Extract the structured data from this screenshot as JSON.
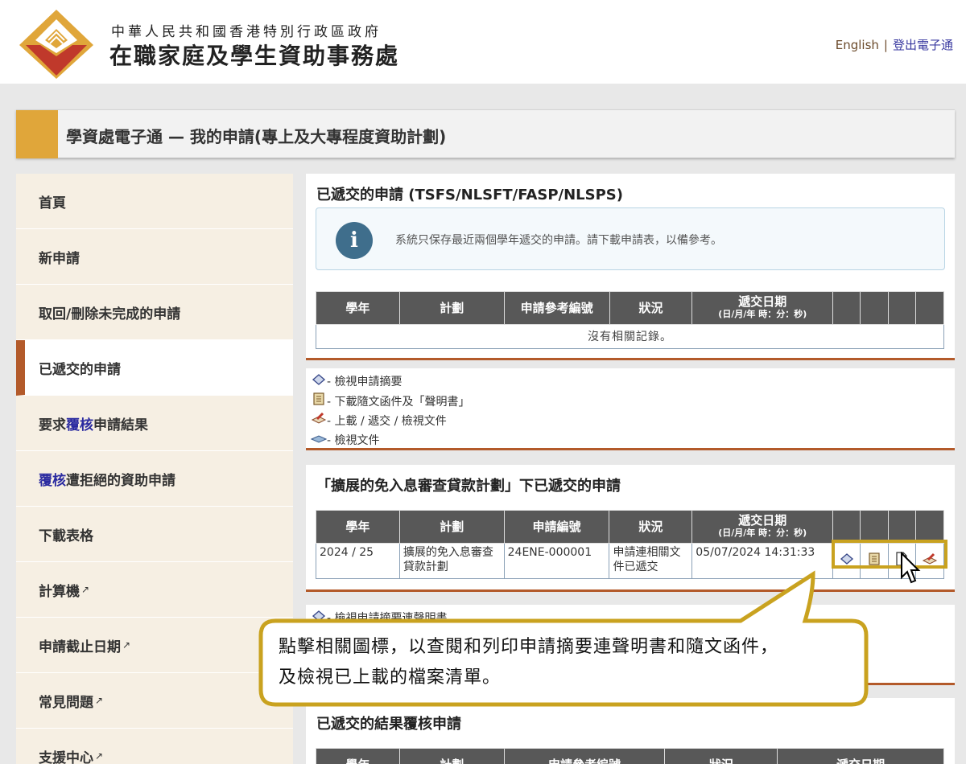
{
  "header": {
    "gov_name": "中華人民共和國香港特別行政區政府",
    "org_name": "在職家庭及學生資助事務處",
    "english_link": "English",
    "separator": "|",
    "logout_link": "登出電子通"
  },
  "titlebar": {
    "title": "學資處電子通 — 我的申請(專上及大專程度資助計劃)"
  },
  "sidebar": {
    "items": [
      {
        "label": "首頁"
      },
      {
        "label": "新申請"
      },
      {
        "label": "取回/刪除未完成的申請"
      },
      {
        "label": "已遞交的申請"
      },
      {
        "label_pre": "要求",
        "label_hl": "覆核",
        "label_post": "申請結果"
      },
      {
        "label_hl": "覆核",
        "label_post": "遭拒絕的資助申請"
      },
      {
        "label": "下載表格"
      },
      {
        "label": "計算機"
      },
      {
        "label": "申請截止日期"
      },
      {
        "label": "常見問題"
      },
      {
        "label": "支援中心"
      }
    ],
    "external_icon": "external-link-icon"
  },
  "section1": {
    "title": "已遞交的申請 (TSFS/NLSFT/FASP/NLSPS)",
    "info": "系統只保存最近兩個學年遞交的申請。請下載申請表，以備參考。",
    "headers": [
      "學年",
      "計劃",
      "申請參考編號",
      "狀況",
      "遞交日期",
      "(日/月/年 時：分：秒)"
    ],
    "empty": "沒有相關記錄。"
  },
  "legend": {
    "items": [
      {
        "icon": "view-summary-icon",
        "label": "- 檢視申請摘要"
      },
      {
        "icon": "download-letter-icon",
        "label": "- 下載隨文函件及「聲明書」"
      },
      {
        "icon": "upload-document-icon",
        "label": "- 上載 / 遞交 / 檢視文件"
      },
      {
        "icon": "view-document-icon",
        "label": "- 檢視文件"
      }
    ]
  },
  "section2": {
    "title": "「擴展的免入息審查貸款計劃」下已遞交的申請",
    "headers": [
      "學年",
      "計劃",
      "申請編號",
      "狀況",
      "遞交日期",
      "(日/月/年 時：分：秒)"
    ],
    "rows": [
      {
        "year": "2024 / 25",
        "scheme": "擴展的免入息審查貸款計劃",
        "app_no": "24ENE-000001",
        "status": "申請連相關文件已遞交",
        "date": "05/07/2024 14:31:33"
      }
    ]
  },
  "section3": {
    "legend_partial": "- 檢視申請摘要連聲明書"
  },
  "section4": {
    "title": "已遞交的結果覆核申請",
    "headers": [
      "學年",
      "計劃",
      "申請參考編號",
      "狀況",
      "遞交日期"
    ]
  },
  "callout": {
    "line1": "點擊相關圖標，以查閱和列印申請摘要連聲明書和隨文函件，",
    "line2": "及檢視已上載的檔案清單。"
  },
  "colors": {
    "accent": "#e0a63a",
    "active_bar": "#b35a2a",
    "table_header": "#585858",
    "highlight": "#c9a21f"
  }
}
